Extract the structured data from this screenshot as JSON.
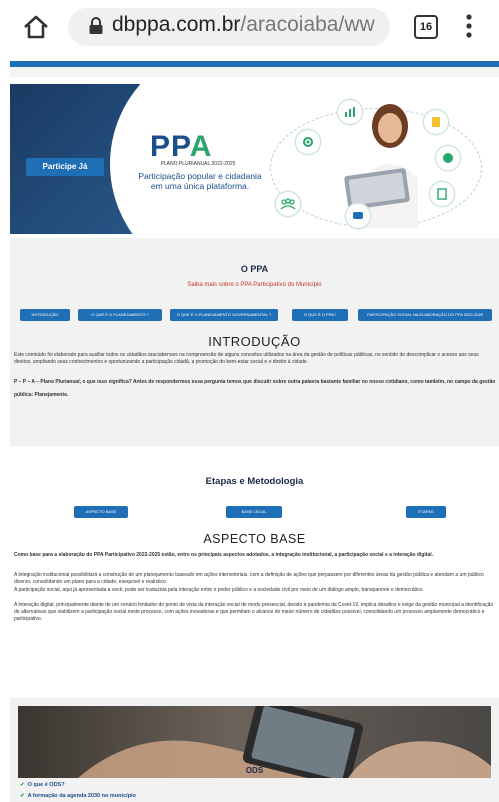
{
  "browser": {
    "url_host": "dbppa.com.br",
    "url_path": "/aracoiaba/ww",
    "tab_count": "16"
  },
  "hero": {
    "participate_button": "Participe Já",
    "logo_main": "PP",
    "logo_accent": "A",
    "logo_subtitle": "PLANO PLURIANUAL 2022-2025",
    "tagline": "Participação popular e cidadania em uma única plataforma."
  },
  "ppa_section": {
    "title": "O PPA",
    "subtitle": "Saiba mais sobre o PPA Participativo do Município",
    "nav_buttons": [
      "INTRODUÇÃO",
      "O QUE É O PLANEJAMENTO ?",
      "O QUE É O PLANEJAMENTO GOVERNAMENTAL ?",
      "O QUE É O PPA?",
      "PARTICIPAÇÃO SOCIAL NA ELABORAÇÃO DO PPA 2022-2025"
    ],
    "heading": "INTRODUÇÃO",
    "paragraph1": "Este conteúdo foi elaborado para auxiliar todos os cidadãos araciabenses na compreensão de alguns conceitos utilizados na área da gestão de políticas públicas, no sentido de descomplicar o acesso aos seus direitos, ampliando seus conhecimentos e oportunizando a participação cidadã, a promoção do bem-estar social e o direito à cidade.",
    "paragraph2_bold": "P – P – A – Plano Plurianual, o que isso significa? Antes de respondermos essa pergunta temos que discutir sobre outra palavra bastante familiar no nosso cotidiano, como também, no campo da gestão pública: Planejamento."
  },
  "etapas_section": {
    "title": "Etapas e Metodologia",
    "nav_buttons": [
      "ASPECTO BASE",
      "BASE LEGAL",
      "ETAPAS"
    ],
    "heading": "ASPECTO BASE",
    "paragraph1_bold": "Como base para a elaboração do PPA Participativo 2022-2025 estão, entre os principais aspectos adotados, a integração institucional, a participação social e a interação digital.",
    "paragraph2": "A integração institucional possibilitará a construção de um planejamento baseado em ações intersetoriais, com a definição de ações que perpassem por diferentes áreas da gestão pública e atendam a um público diverso, consolidando um plano para a cidade, exequível e realístico.",
    "paragraph3": "A participação social, aqui já apresentada a você, pode ser traduzida pela interação entre o poder público e a sociedade civil por meio de um diálogo amplo, transparente e democrático.",
    "paragraph4": "A interação digital, principalmente diante de um cenário limitador do ponto de vista da interação social de modo presencial, devido à pandemia da Covid-19, implica desafios e exige da gestão municipal a identificação de alternativas que viabilizem a participação social neste processo, com ações inovadoras e que permitam o alcance do maior número de cidadãos possível, consolidando um processo amplamente democrático e participativo."
  },
  "ods_section": {
    "title": "ODS",
    "items": [
      "O que é ODS?",
      "A formação da agenda 2030 no município"
    ]
  },
  "colors": {
    "primary_blue": "#1f6fb7",
    "logo_blue": "#1b4e8c",
    "accent_green": "#2aa56b"
  }
}
